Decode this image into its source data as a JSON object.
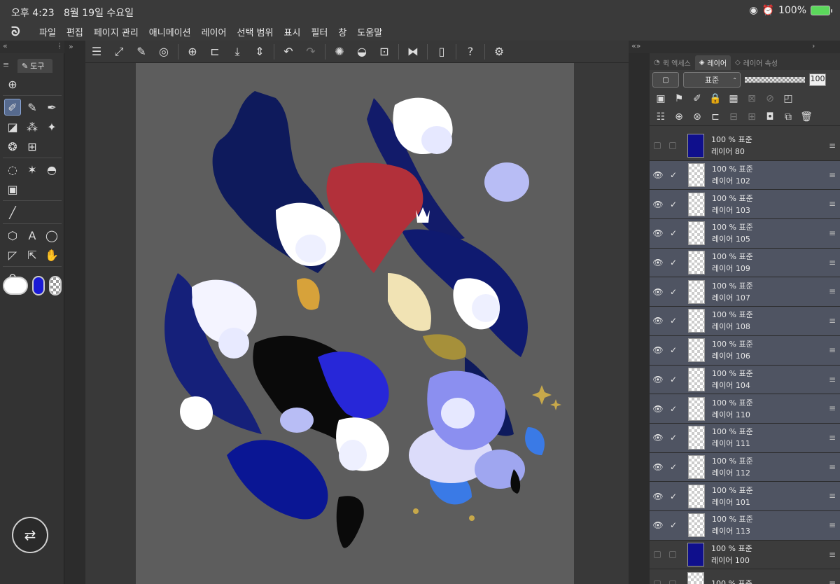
{
  "status": {
    "time": "오후 4:23",
    "date": "8월 19일 수요일",
    "wifi_icon": "wifi-icon",
    "alarm_icon": "alarm-icon",
    "battery": "100%"
  },
  "menu": {
    "logo_icon": "clip-studio-logo-icon",
    "items": [
      "파일",
      "편집",
      "페이지 관리",
      "애니메이션",
      "레이어",
      "선택 범위",
      "표시",
      "필터",
      "창",
      "도움말"
    ]
  },
  "tool_panel": {
    "tab_label": "도구",
    "tools": [
      [
        "download-tool-icon"
      ],
      [
        "pen-tool-icon",
        "pencil-tool-icon",
        "fountain-pen-icon"
      ],
      [
        "eraser-tool-icon",
        "airbrush-tool-icon",
        "sparkle-tool-icon"
      ],
      [
        "blend-tool-icon",
        "grid-tool-icon"
      ],
      [
        "lasso-tool-icon",
        "magic-wand-icon",
        "fill-bucket-icon"
      ],
      [
        "gradient-tool-icon"
      ],
      [
        "line-tool-icon"
      ],
      [
        "3d-object-icon",
        "text-tool-icon",
        "balloon-tool-icon"
      ],
      [
        "ruler-tool-icon",
        "move-tool-icon",
        "hand-tool-icon"
      ],
      [
        "eyedropper-icon"
      ]
    ],
    "colors": {
      "main": "#ffffff",
      "sub": "#1a1ad6",
      "transparent": "checker"
    },
    "swap_icon": "swap-devices-icon"
  },
  "command_bar": [
    "menu-icon",
    "fit-screen-icon",
    "edit-icon",
    "spiral-icon",
    "new-canvas-icon",
    "open-file-icon",
    "save-icon",
    "up-down-icon",
    "undo-icon",
    "redo-icon",
    "loading-icon",
    "fill-icon",
    "transform-icon",
    "flip-horizontal-icon",
    "phone-icon",
    "help-icon",
    "settings-icon"
  ],
  "right_panel": {
    "tabs": [
      "퀵 액세스",
      "레이어",
      "레이어 속성"
    ],
    "active_tab": "레이어",
    "blend_mode": "표준",
    "opacity": "100",
    "layers": [
      {
        "eye": false,
        "thumb": "solid",
        "percent": "100 %",
        "mode": "표준",
        "name": "레이어 80"
      },
      {
        "eye": true,
        "thumb": "checker",
        "percent": "100 %",
        "mode": "표준",
        "name": "레이어 102"
      },
      {
        "eye": true,
        "thumb": "checker",
        "percent": "100 %",
        "mode": "표준",
        "name": "레이어 103"
      },
      {
        "eye": true,
        "thumb": "checker",
        "percent": "100 %",
        "mode": "표준",
        "name": "레이어 105"
      },
      {
        "eye": true,
        "thumb": "checker",
        "percent": "100 %",
        "mode": "표준",
        "name": "레이어 109"
      },
      {
        "eye": true,
        "thumb": "checker",
        "percent": "100 %",
        "mode": "표준",
        "name": "레이어 107"
      },
      {
        "eye": true,
        "thumb": "checker",
        "percent": "100 %",
        "mode": "표준",
        "name": "레이어 108"
      },
      {
        "eye": true,
        "thumb": "checker",
        "percent": "100 %",
        "mode": "표준",
        "name": "레이어 106"
      },
      {
        "eye": true,
        "thumb": "checker",
        "percent": "100 %",
        "mode": "표준",
        "name": "레이어 104"
      },
      {
        "eye": true,
        "thumb": "checker",
        "percent": "100 %",
        "mode": "표준",
        "name": "레이어 110"
      },
      {
        "eye": true,
        "thumb": "checker",
        "percent": "100 %",
        "mode": "표준",
        "name": "레이어 111"
      },
      {
        "eye": true,
        "thumb": "checker",
        "percent": "100 %",
        "mode": "표준",
        "name": "레이어 112"
      },
      {
        "eye": true,
        "thumb": "checker",
        "percent": "100 %",
        "mode": "표준",
        "name": "레이어 101"
      },
      {
        "eye": true,
        "thumb": "checker",
        "percent": "100 %",
        "mode": "표준",
        "name": "레이어 113"
      },
      {
        "eye": false,
        "thumb": "solid",
        "percent": "100 %",
        "mode": "표준",
        "name": "레이어 100"
      },
      {
        "eye": false,
        "thumb": "checker",
        "percent": "100 %",
        "mode": "표준",
        "name": ""
      }
    ]
  }
}
